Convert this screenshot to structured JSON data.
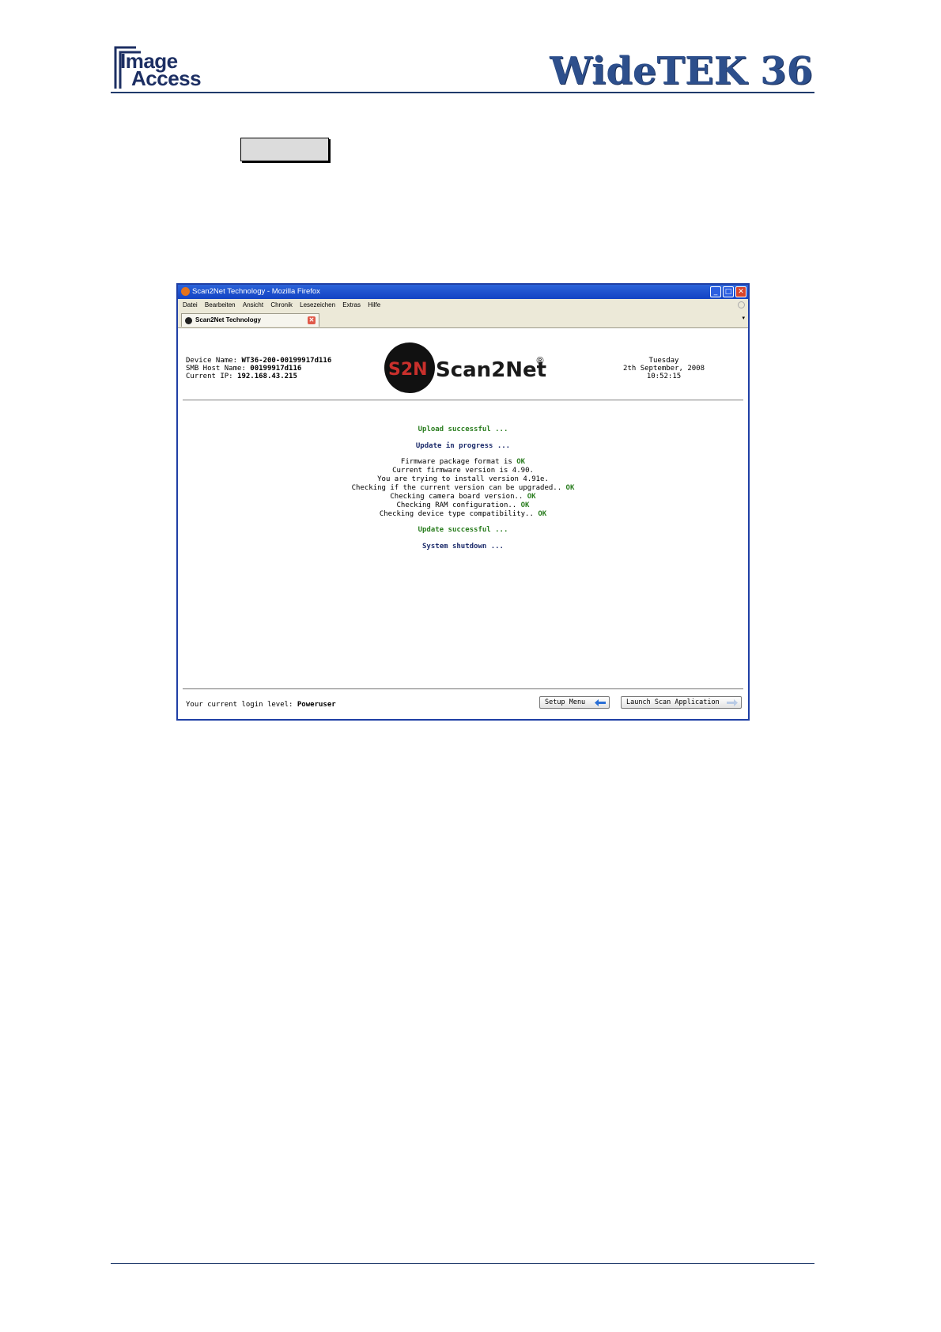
{
  "header": {
    "logo_line1": "Image",
    "logo_line2": "Access",
    "product_title": "WideTEK 36"
  },
  "browser": {
    "window_title": "Scan2Net Technology - Mozilla Firefox",
    "menu_items": [
      "Datei",
      "Bearbeiten",
      "Ansicht",
      "Chronik",
      "Lesezeichen",
      "Extras",
      "Hilfe"
    ],
    "tab_label": "Scan2Net Technology"
  },
  "device": {
    "name_label": "Device Name: ",
    "name_value": "WT36-200-00199917d116",
    "smb_label": "SMB Host Name: ",
    "smb_value": "00199917d116",
    "ip_label": "Current IP: ",
    "ip_value": "192.168.43.215"
  },
  "logo": {
    "mark": "S2N",
    "word": "Scan2Net",
    "registered": "®"
  },
  "datetime": {
    "day": "Tuesday",
    "date": "2th September, 2008",
    "time": "10:52:15"
  },
  "status": {
    "upload": "Upload successful ...",
    "update_progress": "Update in progress ...",
    "checks": [
      {
        "text": "Firmware package format is ",
        "ok": "OK"
      },
      {
        "text": "Current firmware version is 4.90.",
        "ok": ""
      },
      {
        "text": "You are trying to install version 4.91e.",
        "ok": ""
      },
      {
        "text": "Checking if the current version can be upgraded.. ",
        "ok": "OK"
      },
      {
        "text": "Checking camera board version.. ",
        "ok": "OK"
      },
      {
        "text": "Checking RAM configuration.. ",
        "ok": "OK"
      },
      {
        "text": "Checking device type compatibility.. ",
        "ok": "OK"
      }
    ],
    "update_success": "Update successful ...",
    "shutdown": "System shutdown ..."
  },
  "footer": {
    "login_label": "Your current login level: ",
    "login_value": "Poweruser",
    "setup_button": "Setup Menu",
    "launch_button": "Launch Scan Application"
  },
  "colors": {
    "brand_navy": "#1d2f63",
    "title_blue": "#2d4f8c",
    "ok_green": "#2a7d1f",
    "status_navy": "#1c2b6b",
    "xp_titlebar": "#1343c4"
  }
}
